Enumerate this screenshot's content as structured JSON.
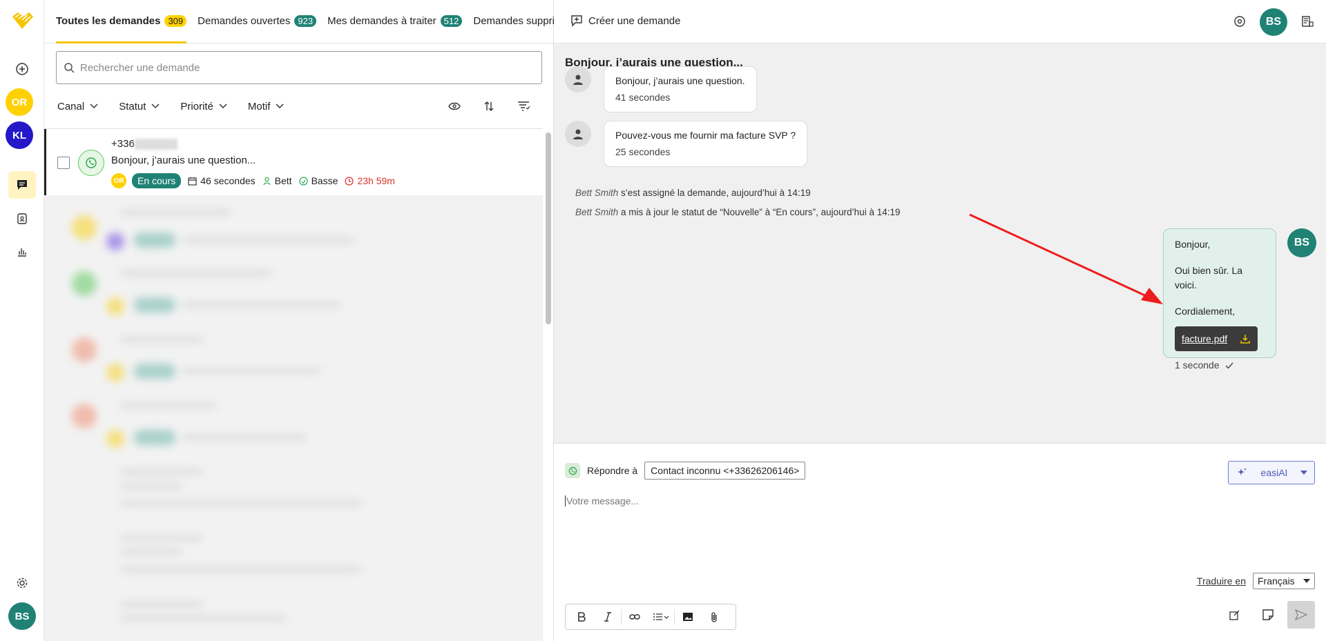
{
  "rail": {
    "avatars": [
      {
        "initials": "OR",
        "color": "#ffd100"
      },
      {
        "initials": "KL",
        "color": "#2418c9"
      }
    ],
    "user_initials": "BS"
  },
  "list": {
    "tabs": [
      {
        "label": "Toutes les demandes",
        "count": "309"
      },
      {
        "label": "Demandes ouvertes",
        "count": "923"
      },
      {
        "label": "Mes demandes à traiter",
        "count": "512"
      },
      {
        "label": "Demandes supprimées"
      }
    ],
    "search_placeholder": "Rechercher une demande",
    "filters": [
      "Canal",
      "Statut",
      "Priorité",
      "Motif"
    ],
    "first_item": {
      "phone": "+336",
      "subject": "Bonjour, j’aurais une question...",
      "assignee_badge": "OR",
      "status": "En cours",
      "age": "46 secondes",
      "agent": "Bett",
      "priority": "Basse",
      "sla": "23h 59m"
    }
  },
  "conversation": {
    "create_label": "Créer une demande",
    "user_initials": "BS",
    "title": "Bonjour, j’aurais une question...",
    "messages": [
      {
        "text": "Bonjour, j’aurais une question.",
        "time": "41 secondes"
      },
      {
        "text": "Pouvez-vous me fournir ma facture SVP ?",
        "time": "25 secondes"
      }
    ],
    "logs": [
      {
        "actor": "Bett Smith",
        "text": " s’est assigné la demande, aujourd’hui à 14:19"
      },
      {
        "actor": "Bett Smith",
        "text": " a mis à jour le statut de “Nouvelle” à “En cours”, aujourd’hui à 14:19"
      }
    ],
    "reply": {
      "line1": "Bonjour,",
      "line2": "Oui bien sûr. La voici.",
      "line3": "Cordialement,",
      "attachment": "facture.pdf",
      "time": "1 seconde",
      "author_initials": "BS"
    }
  },
  "composer": {
    "reply_to_label": "Répondre à",
    "recipient": "Contact inconnu <+33626206146>",
    "ai_label": "easiAI",
    "placeholder": "Votre message...",
    "translate_label": "Traduire en",
    "language": "Français"
  },
  "colors": {
    "accent": "#ffd100",
    "teal": "#1f8275",
    "red": "#d9332b"
  }
}
